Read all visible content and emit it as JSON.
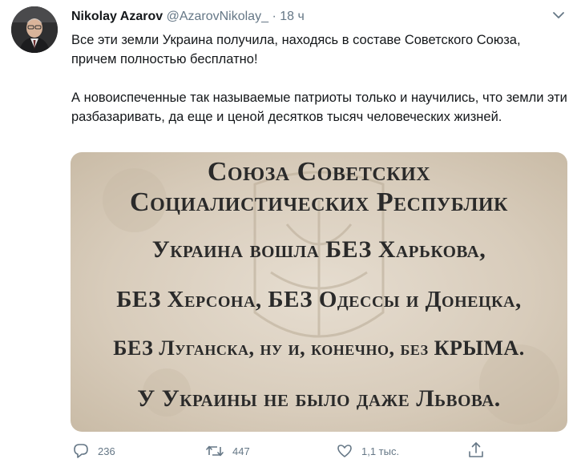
{
  "author": {
    "name": "Nikolay Azarov",
    "handle": "@AzarovNikolay_",
    "separator": "·",
    "time": "18 ч"
  },
  "tweet": {
    "paragraph1": "Все эти земли Украина получила, находясь в составе Советского Союза, причем полностью бесплатно!",
    "paragraph2": "А новоиспеченные так называемые патриоты только и научились, что земли эти разбазаривать, да еще и ценой десятков тысяч человеческих жизней."
  },
  "image_text": {
    "line1": "Союза Советских",
    "line2": "Социалистических Республик",
    "line3": "Украина вошла БЕЗ Харькова,",
    "line4": "БЕЗ Херсона, БЕЗ Одессы и Донецка,",
    "line5": "БЕЗ Луганска, ну и, конечно, без КРЫМА.",
    "line6": "У Украины не было даже Львова."
  },
  "actions": {
    "replies": "236",
    "retweets": "447",
    "likes": "1,1 тыс."
  },
  "icons": {
    "avatar": "avatar-photo",
    "caret": "chevron-down-icon",
    "reply": "reply-icon",
    "retweet": "retweet-icon",
    "like": "heart-icon",
    "share": "share-icon"
  },
  "colors": {
    "text": "#14171a",
    "muted": "#657786",
    "image_bg": "#ddd2c3"
  }
}
